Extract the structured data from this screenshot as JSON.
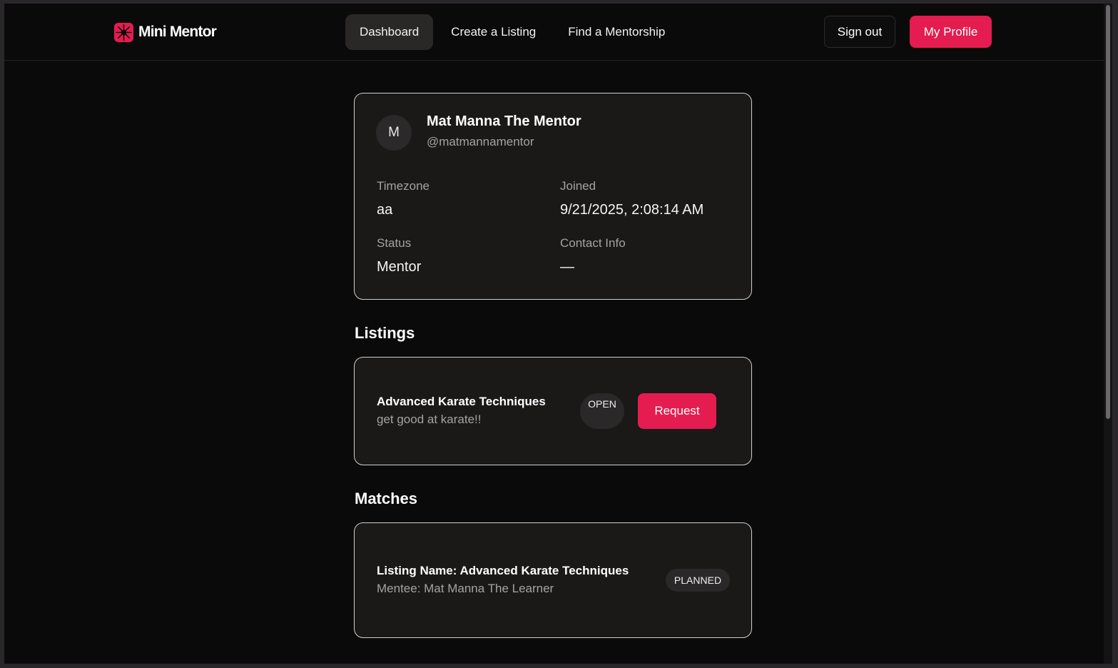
{
  "brand": {
    "name": "Mini Mentor",
    "icon": "sunburst-logo-icon",
    "accent": "#e41c4f"
  },
  "nav": {
    "links": [
      {
        "label": "Dashboard",
        "active": true
      },
      {
        "label": "Create a Listing",
        "active": false
      },
      {
        "label": "Find a Mentorship",
        "active": false
      }
    ],
    "sign_out": "Sign out",
    "my_profile": "My Profile"
  },
  "profile": {
    "avatar_letter": "M",
    "name": "Mat Manna The Mentor",
    "handle": "@matmannamentor",
    "timezone_label": "Timezone",
    "timezone_value": "aa",
    "joined_label": "Joined",
    "joined_value": "9/21/2025, 2:08:14 AM",
    "status_label": "Status",
    "status_value": "Mentor",
    "contact_label": "Contact Info",
    "contact_value": "—"
  },
  "listings": {
    "title": "Listings",
    "items": [
      {
        "title": "Advanced Karate Techniques",
        "description": "get good at karate!!",
        "status": "OPEN",
        "action": "Request"
      }
    ]
  },
  "matches": {
    "title": "Matches",
    "items": [
      {
        "title": "Listing Name: Advanced Karate Techniques",
        "mentee": "Mentee: Mat Manna The Learner",
        "status": "PLANNED"
      }
    ]
  }
}
